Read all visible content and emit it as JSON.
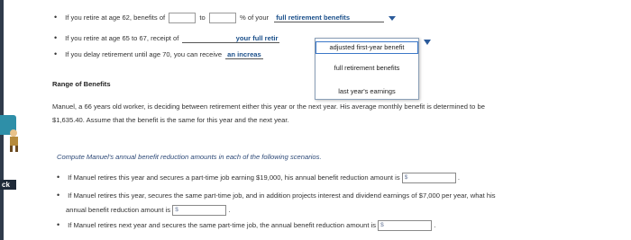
{
  "bullets": {
    "item1": {
      "prefix": "If you retire at age 62, benefits of",
      "to": "to",
      "suffix": "% of your",
      "dropdown_value": "full retirement benefits"
    },
    "item2": {
      "prefix": "If you retire at age 65 to 67, receipt of",
      "dropdown_value": "your full retir"
    },
    "item3": {
      "prefix": "If you delay retirement until age 70, you can receive",
      "dropdown_value": "an increas"
    }
  },
  "dropdown_menu": {
    "options": [
      "adjusted first-year benefit",
      "full retirement benefits",
      "last year's earnings"
    ]
  },
  "range_heading": "Range of Benefits",
  "paragraph": {
    "line1": "Manuel, a 66 years old worker, is deciding between retirement either this year or the next year. His average monthly benefit is determined to be",
    "line2": "$1,635.40. Assume that the benefit is the same for this year and the next year."
  },
  "instruction": "Compute Manuel's annual benefit reduction amounts in each of the following scenarios.",
  "scenarios": [
    {
      "text": "If Manuel retires this year and secures a part-time job earning $19,000, his annual benefit reduction amount is",
      "placeholder": "$"
    },
    {
      "text_line1": "If Manuel retires this year, secures the same part-time job, and in addition projects interest and dividend earnings of $7,000 per year, what his",
      "text_line2": "annual benefit reduction amount is",
      "placeholder": "$"
    },
    {
      "text": "If Manuel retires next year and secures the same part-time job, the annual benefit reduction amount is",
      "placeholder": "$"
    }
  ],
  "sidebar_label": "ck"
}
